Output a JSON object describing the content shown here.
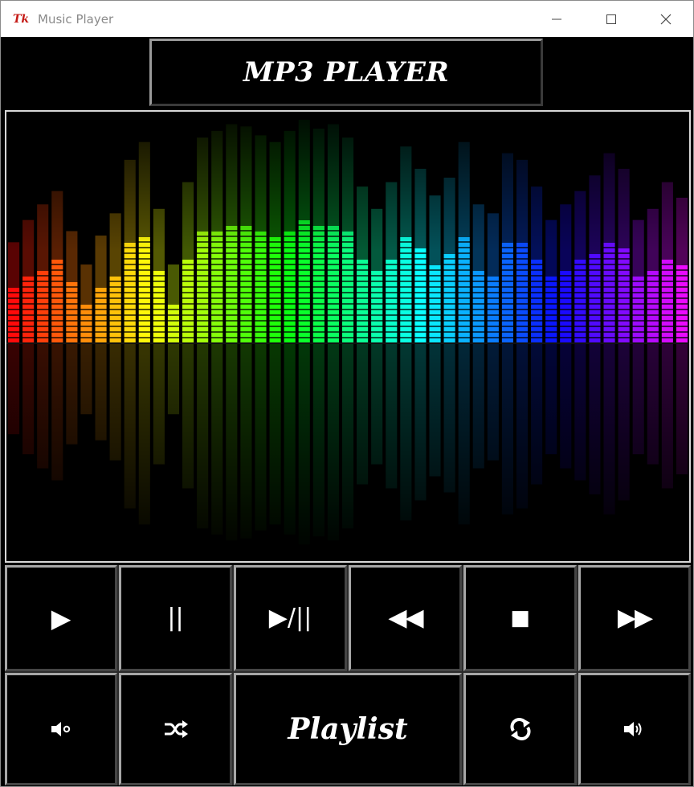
{
  "window": {
    "title": "Music Player",
    "app_icon_text": "Tk",
    "controls": {
      "minimize_icon": "minimize-icon",
      "maximize_icon": "maximize-icon",
      "close_icon": "close-icon"
    }
  },
  "header": {
    "title": "MP3 PLAYER"
  },
  "visualizer": {
    "image": "rainbow-equalizer-bars"
  },
  "controls": {
    "row1": [
      {
        "name": "play-button",
        "label": "▶",
        "icon": "play-icon"
      },
      {
        "name": "pause-button",
        "label": "||",
        "icon": "pause-icon"
      },
      {
        "name": "play-pause-button",
        "label": "▶/||",
        "icon": "play-pause-icon"
      },
      {
        "name": "rewind-button",
        "label": "◀◀",
        "icon": "rewind-icon"
      },
      {
        "name": "stop-button",
        "label": "■",
        "icon": "stop-icon"
      },
      {
        "name": "fast-forward-button",
        "label": "▶▶",
        "icon": "fast-forward-icon"
      }
    ],
    "row2": {
      "mute": {
        "icon": "volume-mute-icon"
      },
      "shuffle": {
        "icon": "shuffle-icon"
      },
      "playlist": {
        "label": "Playlist"
      },
      "repeat": {
        "icon": "repeat-icon"
      },
      "volume": {
        "icon": "volume-up-icon"
      }
    }
  },
  "colors": {
    "background": "#000000",
    "button_border_light": "#a7a7a7",
    "button_border_dark": "#454545",
    "text": "#ffffff",
    "app_icon": "#c41a16"
  }
}
